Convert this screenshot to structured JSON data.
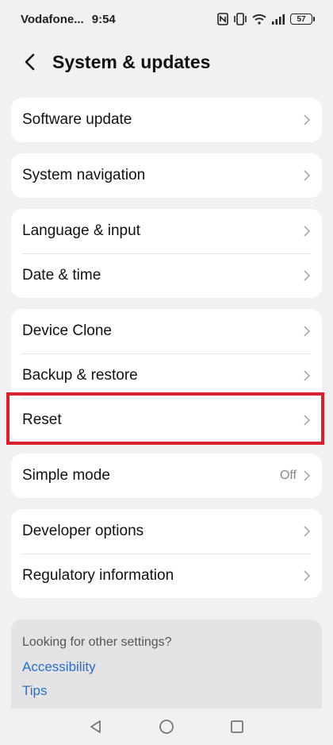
{
  "status_bar": {
    "carrier": "Vodafone...",
    "time": "9:54",
    "battery": "57",
    "icons": [
      "nfc-icon",
      "vibrate-icon",
      "wifi-icon",
      "signal-icon",
      "battery-icon"
    ]
  },
  "header": {
    "title": "System & updates",
    "back_icon": "chevron-left-icon"
  },
  "groups": [
    {
      "items": [
        {
          "label": "Software update"
        }
      ]
    },
    {
      "items": [
        {
          "label": "System navigation"
        }
      ]
    },
    {
      "items": [
        {
          "label": "Language & input"
        },
        {
          "label": "Date & time"
        }
      ]
    },
    {
      "items": [
        {
          "label": "Device Clone"
        },
        {
          "label": "Backup & restore"
        },
        {
          "label": "Reset"
        }
      ]
    },
    {
      "items": [
        {
          "label": "Simple mode",
          "value": "Off"
        }
      ]
    },
    {
      "items": [
        {
          "label": "Developer options"
        },
        {
          "label": "Regulatory information"
        }
      ]
    }
  ],
  "suggestions": {
    "title": "Looking for other settings?",
    "links": [
      "Accessibility",
      "Tips"
    ]
  },
  "colors": {
    "background": "#f1f1f3",
    "card": "#ffffff",
    "link": "#2a6fc9",
    "highlight": "#d8202e"
  },
  "nav_bar": [
    "back-triangle-icon",
    "home-circle-icon",
    "recents-square-icon"
  ]
}
